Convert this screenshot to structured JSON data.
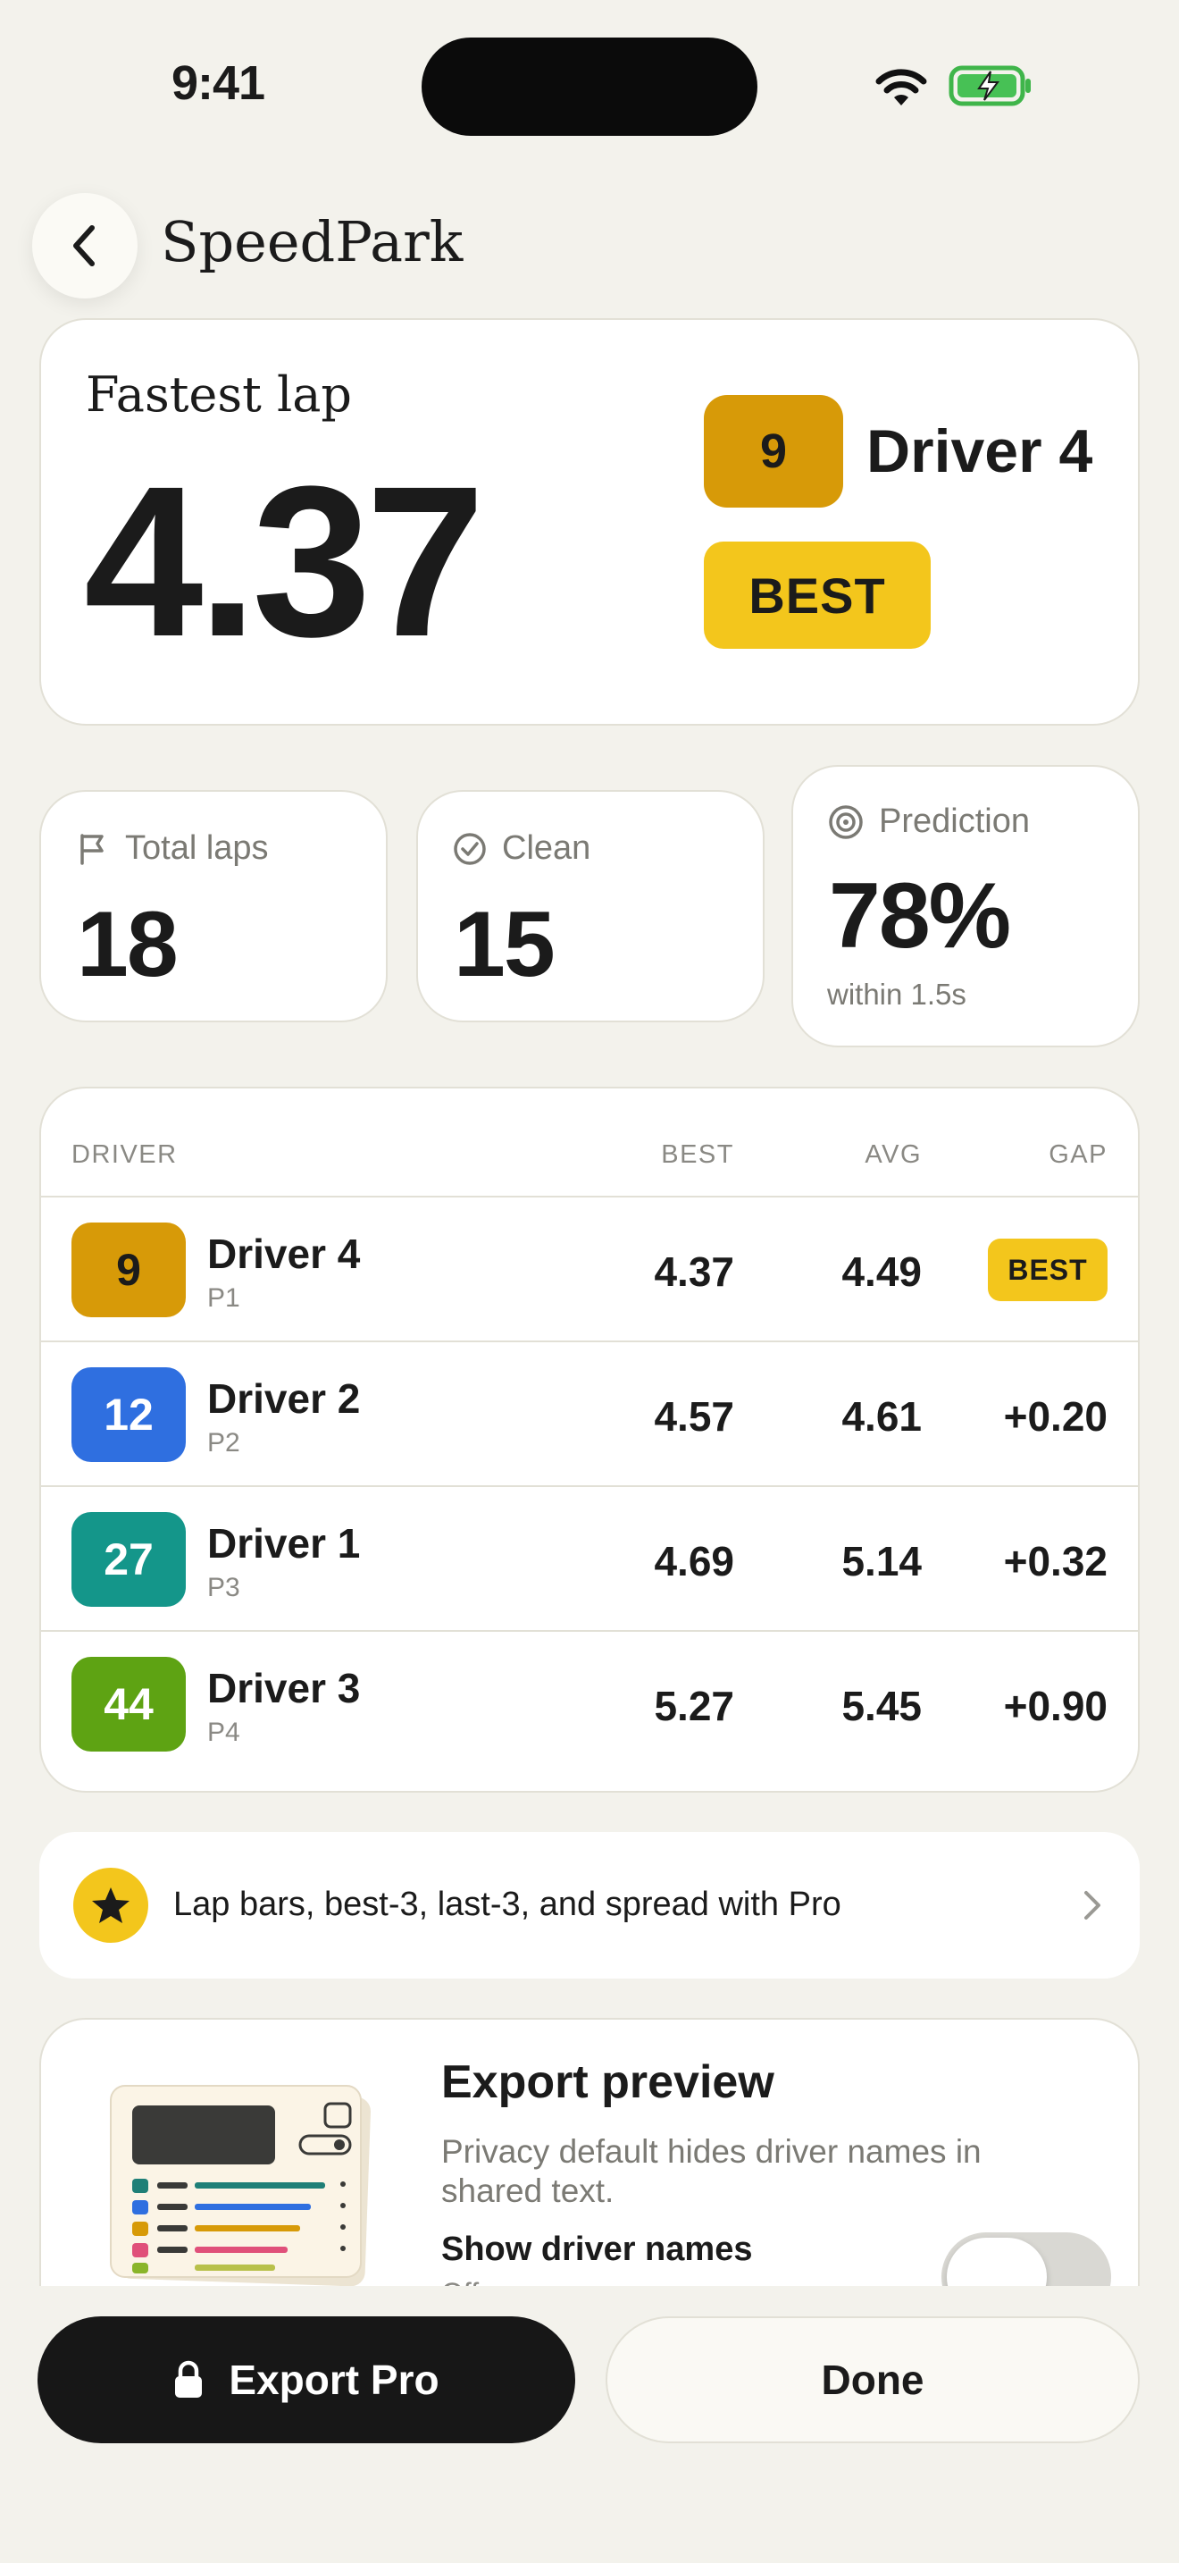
{
  "status_bar": {
    "time": "9:41"
  },
  "nav": {
    "title": "SpeedPark"
  },
  "hero": {
    "label": "Fastest lap",
    "time": "4.37",
    "driver_number": "9",
    "driver_name": "Driver 4",
    "badge": "BEST"
  },
  "stats": {
    "total_laps": {
      "label": "Total laps",
      "value": "18"
    },
    "clean": {
      "label": "Clean",
      "value": "15"
    },
    "prediction": {
      "label": "Prediction",
      "value": "78%",
      "sub": "within 1.5s"
    }
  },
  "table": {
    "headers": {
      "driver": "DRIVER",
      "best": "BEST",
      "avg": "AVG",
      "gap": "GAP"
    },
    "rows": [
      {
        "number": "9",
        "color": "#d79a08",
        "text_color": "#1b1b1b",
        "name": "Driver 4",
        "pos": "P1",
        "best": "4.37",
        "avg": "4.49",
        "gap": "BEST"
      },
      {
        "number": "12",
        "color": "#2f6fe0",
        "text_color": "#ffffff",
        "name": "Driver 2",
        "pos": "P2",
        "best": "4.57",
        "avg": "4.61",
        "gap": "+0.20"
      },
      {
        "number": "27",
        "color": "#14968a",
        "text_color": "#ffffff",
        "name": "Driver 1",
        "pos": "P3",
        "best": "4.69",
        "avg": "5.14",
        "gap": "+0.32"
      },
      {
        "number": "44",
        "color": "#5ea313",
        "text_color": "#ffffff",
        "name": "Driver 3",
        "pos": "P4",
        "best": "5.27",
        "avg": "5.45",
        "gap": "+0.90"
      }
    ]
  },
  "promo": {
    "text": "Lap bars, best-3, last-3, and spread with Pro"
  },
  "export": {
    "title": "Export preview",
    "description": "Privacy default hides driver names in shared text.",
    "toggle_label": "Show driver names",
    "toggle_state": "Off"
  },
  "actions": {
    "pro_label": "Export Pro",
    "done_label": "Done"
  },
  "colors": {
    "accent_yellow": "#f3c61c",
    "dark": "#171717",
    "background": "#f3f2ec"
  }
}
